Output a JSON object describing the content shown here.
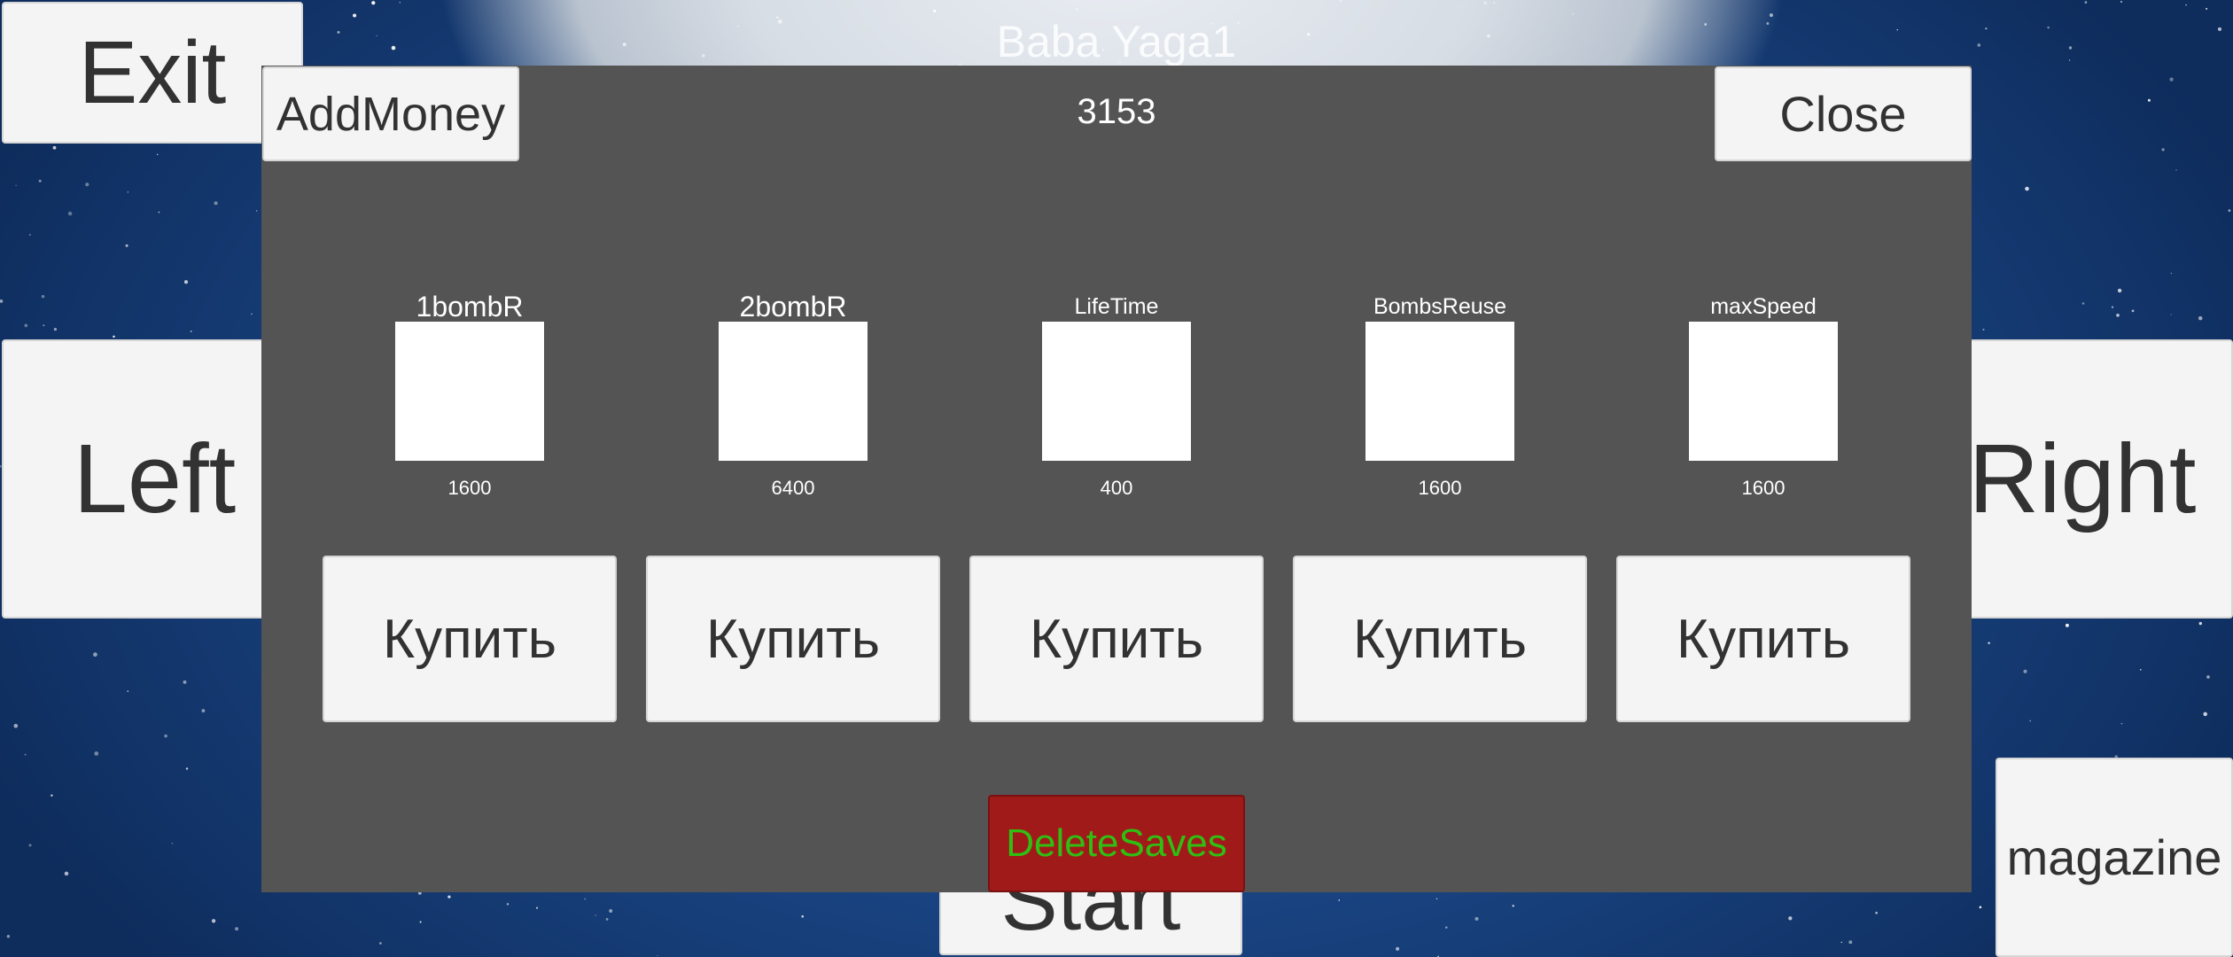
{
  "hud": {
    "exit_label": "Exit",
    "left_label": "Left",
    "right_label": "Right",
    "start_label": "Start",
    "magazine_label": "magazine",
    "player_name": "Baba Yaga1"
  },
  "shop": {
    "add_money_label": "AddMoney",
    "close_label": "Close",
    "money": "3153",
    "delete_saves_label": "DeleteSaves",
    "items": [
      {
        "name": "1bombR",
        "price": "1600",
        "buy_label": "Купить"
      },
      {
        "name": "2bombR",
        "price": "6400",
        "buy_label": "Купить"
      },
      {
        "name": "LifeTime",
        "price": "400",
        "buy_label": "Купить"
      },
      {
        "name": "BombsReuse",
        "price": "1600",
        "buy_label": "Купить"
      },
      {
        "name": "maxSpeed",
        "price": "1600",
        "buy_label": "Купить"
      }
    ]
  },
  "colors": {
    "panel": "#545454",
    "button": "#f4f4f4",
    "button_text": "#323232",
    "delete_bg": "#a01a1a",
    "delete_text": "#2fbf12"
  }
}
